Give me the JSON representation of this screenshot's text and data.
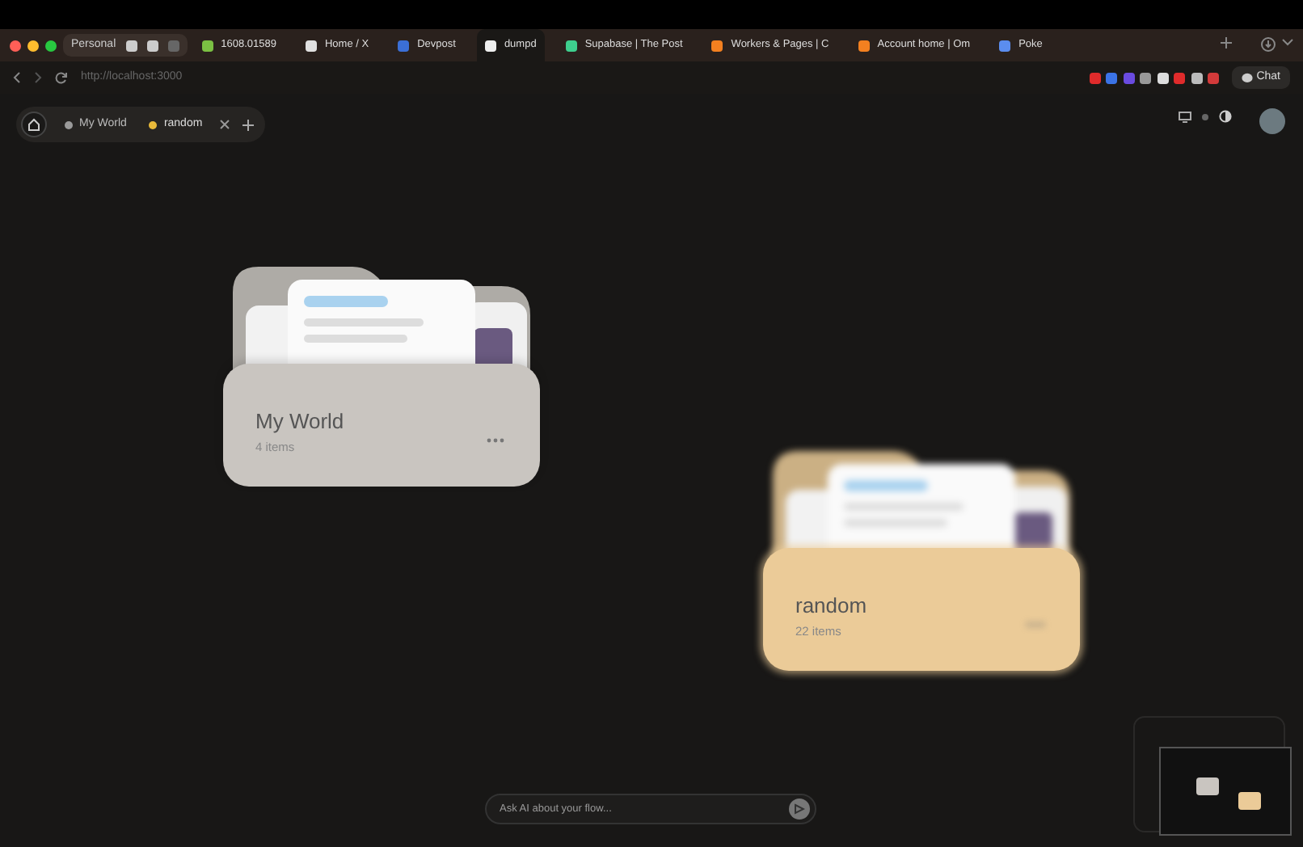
{
  "browser": {
    "profile": "Personal",
    "tabs": [
      {
        "label": "1608.01589",
        "selected": false,
        "color": "#7bc043"
      },
      {
        "label": "Home / X",
        "selected": false,
        "color": "#e0e0e0"
      },
      {
        "label": "Devpost",
        "selected": false,
        "color": "#3b6fd6"
      },
      {
        "label": "dumpd",
        "selected": true,
        "color": "#eeeeee"
      },
      {
        "label": "Supabase | The Post",
        "selected": false,
        "color": "#3ecf8e"
      },
      {
        "label": "Workers & Pages | C",
        "selected": false,
        "color": "#f38020"
      },
      {
        "label": "Account home | Om",
        "selected": false,
        "color": "#f38020"
      },
      {
        "label": "Poke",
        "selected": false,
        "color": "#5b8def"
      }
    ],
    "url": "http://localhost:3000",
    "chat_button": "Chat"
  },
  "app": {
    "tabs": [
      {
        "label": "My World",
        "color": "#9a9a9a",
        "selected": false
      },
      {
        "label": "random",
        "color": "#e8b93a",
        "selected": true
      }
    ],
    "folders": [
      {
        "name": "My World",
        "count": "4 items",
        "color": "#c9c5c0",
        "blurred": false
      },
      {
        "name": "random",
        "count": "22 items",
        "color": "#ebcb98",
        "blurred": true
      }
    ],
    "chat": {
      "placeholder": "Ask AI about your flow..."
    }
  }
}
